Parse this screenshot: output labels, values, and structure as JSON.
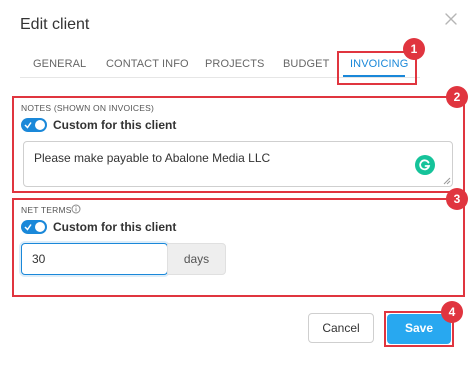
{
  "dialog": {
    "title": "Edit client"
  },
  "tabs": [
    {
      "label": "GENERAL"
    },
    {
      "label": "CONTACT INFO"
    },
    {
      "label": "PROJECTS"
    },
    {
      "label": "BUDGET"
    },
    {
      "label": "INVOICING",
      "active": true
    }
  ],
  "notes": {
    "section_label": "NOTES (SHOWN ON INVOICES)",
    "toggle_label": "Custom for this client",
    "toggle_on": true,
    "value": "Please make payable to Abalone Media LLC"
  },
  "net_terms": {
    "section_label": "NET TERMS",
    "toggle_label": "Custom for this client",
    "toggle_on": true,
    "value": "30",
    "unit": "days"
  },
  "buttons": {
    "cancel_label": "Cancel",
    "save_label": "Save"
  },
  "callouts": [
    "1",
    "2",
    "3",
    "4"
  ],
  "colors": {
    "accent": "#1a88d9",
    "callout": "#e0353f",
    "save": "#28a8f0"
  }
}
